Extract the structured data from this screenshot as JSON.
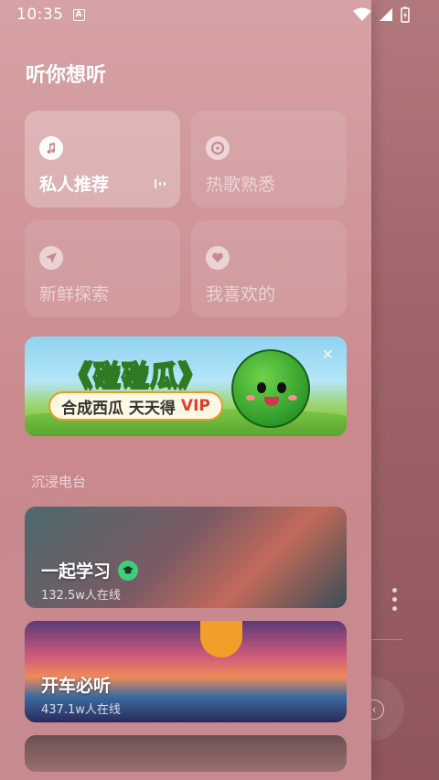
{
  "status": {
    "time": "10:35",
    "a_label": "A"
  },
  "drawer": {
    "title": "听你想听",
    "cards": [
      {
        "label": "私人推荐",
        "icon": "music-note-icon",
        "active": true
      },
      {
        "label": "热歌熟悉",
        "icon": "disc-icon",
        "active": false
      },
      {
        "label": "新鲜探索",
        "icon": "send-icon",
        "active": false
      },
      {
        "label": "我喜欢的",
        "icon": "heart-icon",
        "active": false
      }
    ],
    "banner": {
      "title": "《碰碰瓜》",
      "subtitle": "合成西瓜 天天得",
      "vip": "VIP",
      "close": "✕"
    },
    "section_label": "沉浸电台",
    "radios": [
      {
        "name": "一起学习",
        "listeners": "132.5w人在线",
        "verified": true
      },
      {
        "name": "开车必听",
        "listeners": "437.1w人在线",
        "verified": false
      }
    ]
  },
  "colors": {
    "accent": "#3ecf7a",
    "drawer_bg": "#cf9598",
    "page_bg": "#a56b70"
  }
}
